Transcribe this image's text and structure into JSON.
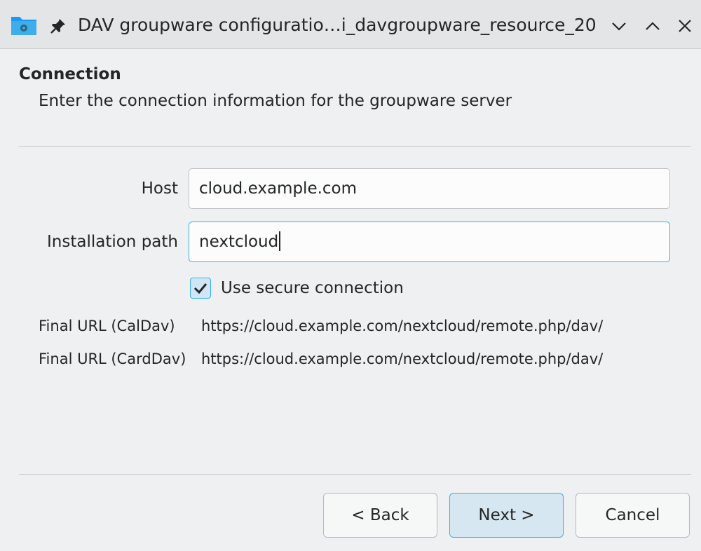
{
  "window": {
    "title": "DAV groupware configuratio…i_davgroupware_resource_20",
    "app_icon": "folder-network-icon",
    "pin_icon": "pin-icon",
    "controls": [
      "minimize-icon",
      "maximize-icon",
      "close-icon"
    ]
  },
  "page": {
    "heading": "Connection",
    "subheading": "Enter the connection information for the groupware server"
  },
  "form": {
    "host_label": "Host",
    "host_value": "cloud.example.com",
    "path_label": "Installation path",
    "path_value": "nextcloud",
    "secure_label": "Use secure connection",
    "secure_checked": true,
    "caldav_label": "Final URL (CalDav)",
    "caldav_value": "https://cloud.example.com/nextcloud/remote.php/dav/",
    "carddav_label": "Final URL (CardDav)",
    "carddav_value": "https://cloud.example.com/nextcloud/remote.php/dav/"
  },
  "buttons": {
    "back": "< Back",
    "next": "Next >",
    "cancel": "Cancel"
  },
  "colors": {
    "accent": "#3daee9",
    "background": "#eff0f1"
  }
}
